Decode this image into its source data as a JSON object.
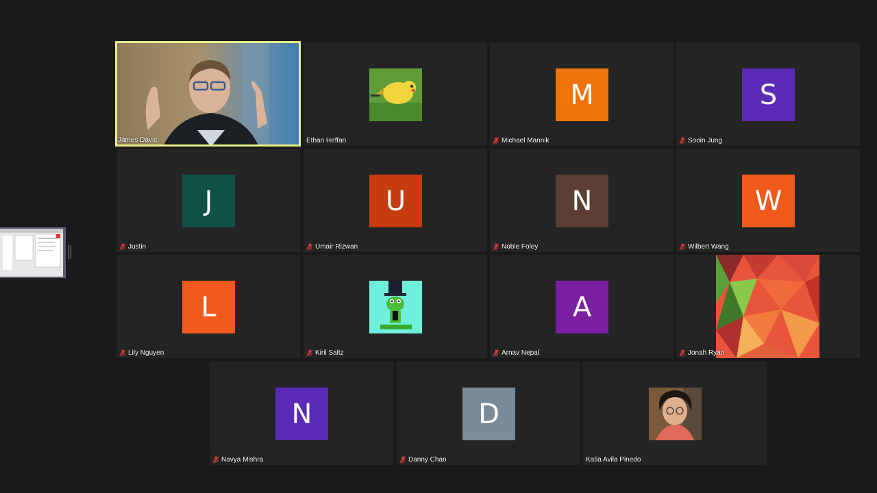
{
  "participants": [
    {
      "name": "James Davis",
      "muted": false,
      "type": "video",
      "speaking": true
    },
    {
      "name": "Ethan Heffan",
      "muted": false,
      "type": "image",
      "image": "pikachu"
    },
    {
      "name": "Michael Mannik",
      "muted": true,
      "type": "letter",
      "letter": "M",
      "color": "#ee7309"
    },
    {
      "name": "Sooin Jung",
      "muted": true,
      "type": "letter",
      "letter": "S",
      "color": "#5b2ab6"
    },
    {
      "name": "Justin",
      "muted": true,
      "type": "letter",
      "letter": "J",
      "color": "#0e5246"
    },
    {
      "name": "Umair Rizwan",
      "muted": true,
      "type": "letter",
      "letter": "U",
      "color": "#c63b10"
    },
    {
      "name": "Noble Foley",
      "muted": true,
      "type": "letter",
      "letter": "N",
      "color": "#5c3e34"
    },
    {
      "name": "Wilbert Wang",
      "muted": true,
      "type": "letter",
      "letter": "W",
      "color": "#f25a1c"
    },
    {
      "name": "Lily Nguyen",
      "muted": true,
      "type": "letter",
      "letter": "L",
      "color": "#f25a1c"
    },
    {
      "name": "Kiril Saltz",
      "muted": true,
      "type": "image",
      "image": "frog-top-hat"
    },
    {
      "name": "Arnav Nepal",
      "muted": true,
      "type": "letter",
      "letter": "A",
      "color": "#7b1fa2"
    },
    {
      "name": "Jonah Ryan",
      "muted": true,
      "type": "image",
      "image": "polygon-pattern"
    },
    {
      "name": "Navya Mishra",
      "muted": true,
      "type": "letter",
      "letter": "N",
      "color": "#5b2ab6"
    },
    {
      "name": "Danny Chan",
      "muted": true,
      "type": "letter",
      "letter": "D",
      "color": "#7a8c99"
    },
    {
      "name": "Katia Avila Pinedo",
      "muted": false,
      "type": "image",
      "image": "person-photo"
    }
  ]
}
